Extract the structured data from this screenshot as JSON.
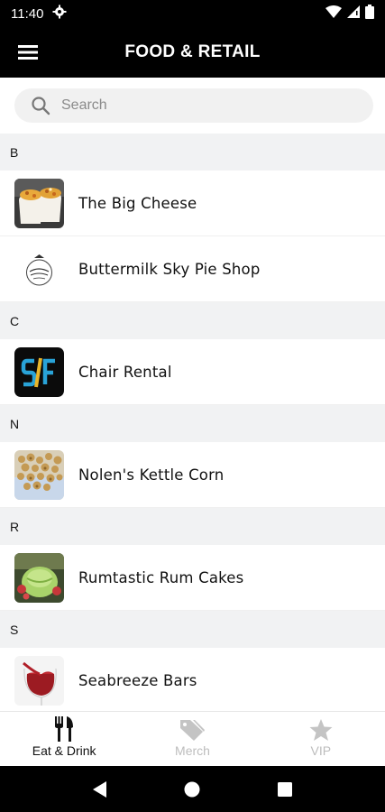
{
  "status_bar": {
    "time": "11:40"
  },
  "app_bar": {
    "title": "FOOD & RETAIL"
  },
  "search": {
    "placeholder": "Search",
    "value": ""
  },
  "sections": [
    {
      "letter": "B",
      "items": [
        {
          "name": "The Big Cheese",
          "thumb": "mac-and-cheese-photo"
        },
        {
          "name": "Buttermilk Sky Pie Shop",
          "thumb": "buttermilk-logo"
        }
      ]
    },
    {
      "letter": "C",
      "items": [
        {
          "name": "Chair Rental",
          "thumb": "sf-logo"
        }
      ]
    },
    {
      "letter": "N",
      "items": [
        {
          "name": "Nolen's Kettle Corn",
          "thumb": "kettle-corn-photo"
        }
      ]
    },
    {
      "letter": "R",
      "items": [
        {
          "name": "Rumtastic Rum Cakes",
          "thumb": "rum-cake-photo"
        }
      ]
    },
    {
      "letter": "S",
      "items": [
        {
          "name": "Seabreeze Bars",
          "thumb": "wine-glass-photo"
        }
      ]
    }
  ],
  "tabs": [
    {
      "label": "Eat & Drink",
      "icon": "fork-knife-icon",
      "active": true
    },
    {
      "label": "Merch",
      "icon": "tag-icon",
      "active": false
    },
    {
      "label": "VIP",
      "icon": "star-icon",
      "active": false
    }
  ],
  "colors": {
    "bar": "#000000",
    "section_bg": "#f1f2f3",
    "inactive_tab": "#bdbdbd"
  }
}
